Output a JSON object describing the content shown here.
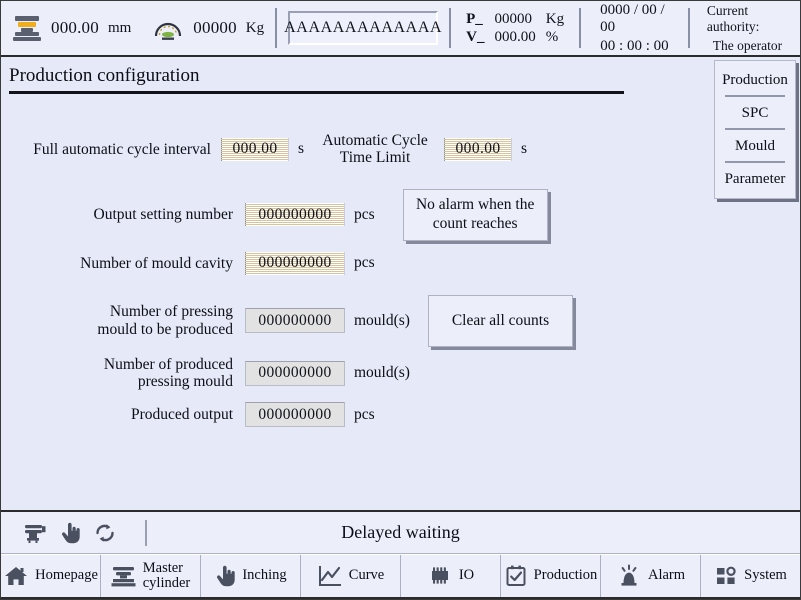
{
  "topbar": {
    "position": {
      "icon": "press-icon",
      "value": "000.00",
      "unit": "mm"
    },
    "load": {
      "icon": "gauge-icon",
      "value": "00000",
      "unit": "Kg"
    },
    "text_field": {
      "value": "AAAAAAAAAAAAA"
    },
    "pressure": {
      "label": "P_",
      "value": "00000",
      "unit": "Kg"
    },
    "velocity": {
      "label": "V_",
      "value": "000.00",
      "unit": "%"
    },
    "date": "0000 / 00 / 00",
    "time": "00 : 00 : 00",
    "authority_label": "Current authority:",
    "authority_value": "The operator"
  },
  "page": {
    "title": "Production configuration"
  },
  "form": {
    "cycle_interval": {
      "label": "Full automatic cycle interval",
      "value": "000.00",
      "unit": "s"
    },
    "cycle_time_limit": {
      "label_line1": "Automatic Cycle",
      "label_line2": "Time Limit",
      "value": "000.00",
      "unit": "s"
    },
    "output_setting": {
      "label": "Output setting number",
      "value": "000000000",
      "unit": "pcs"
    },
    "mould_cavity": {
      "label": "Number of mould cavity",
      "value": "000000000",
      "unit": "pcs"
    },
    "pressing_to_produce": {
      "label_line1": "Number of pressing",
      "label_line2": "mould to be produced",
      "value": "000000000",
      "unit": "mould(s)"
    },
    "pressing_produced": {
      "label_line1": "Number of produced",
      "label_line2": "pressing mould",
      "value": "000000000",
      "unit": "mould(s)"
    },
    "produced_output": {
      "label": "Produced output",
      "value": "000000000",
      "unit": "pcs"
    },
    "no_alarm_button": {
      "line1": "No alarm when the",
      "line2": "count reaches"
    },
    "clear_counts_button": {
      "label": "Clear all counts"
    }
  },
  "sidebar": {
    "items": [
      {
        "label": "Production",
        "icon": "production-tab"
      },
      {
        "label": "SPC",
        "icon": "spc-tab"
      },
      {
        "label": "Mould",
        "icon": "mould-tab"
      },
      {
        "label": "Parameter",
        "icon": "parameter-tab"
      }
    ]
  },
  "statusbar": {
    "icons": [
      "machine-icon",
      "hand-icon",
      "cycle-refresh-icon"
    ],
    "message": "Delayed waiting"
  },
  "nav": {
    "items": [
      {
        "label": "Homepage",
        "label2": "",
        "icon": "home-icon"
      },
      {
        "label": "Master",
        "label2": "cylinder",
        "icon": "press-bars-icon"
      },
      {
        "label": "Inching",
        "label2": "",
        "icon": "hand-icon"
      },
      {
        "label": "Curve",
        "label2": "",
        "icon": "chart-line-icon"
      },
      {
        "label": "IO",
        "label2": "",
        "icon": "chip-icon"
      },
      {
        "label": "Production",
        "label2": "",
        "icon": "clipboard-check-icon"
      },
      {
        "label": "Alarm",
        "label2": "",
        "icon": "alarm-beacon-icon"
      },
      {
        "label": "System",
        "label2": "",
        "icon": "grid-squares-icon"
      }
    ]
  },
  "colors": {
    "background": "#e6eaf8",
    "panel": "#eceffa",
    "accent_yellow": "#f0ae1d",
    "icon_gray": "#5b6070",
    "field_stripe": "#d8c39b"
  }
}
